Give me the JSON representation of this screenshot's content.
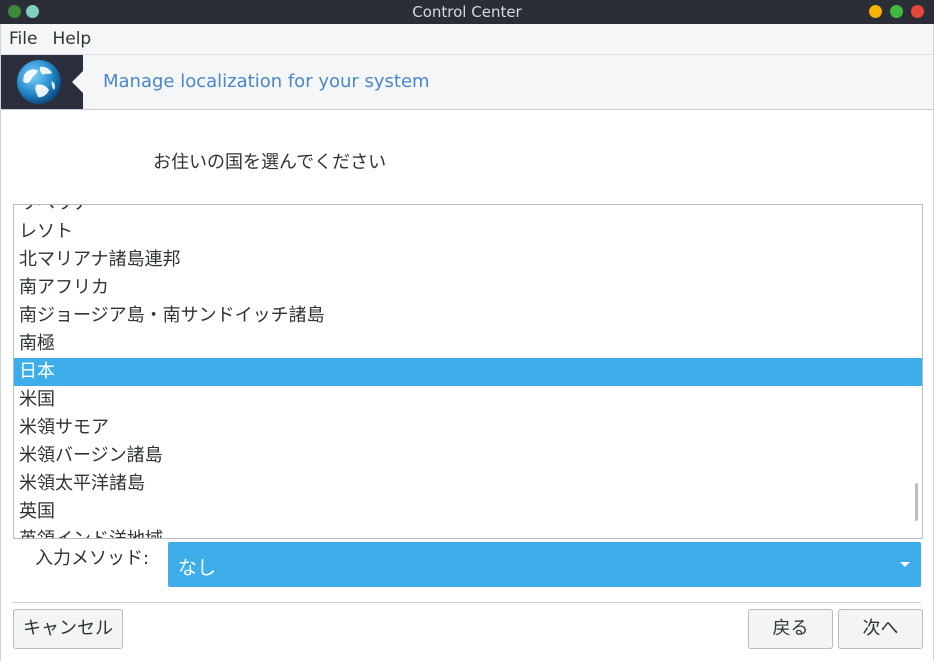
{
  "window": {
    "title": "Control Center"
  },
  "menu": {
    "file": "File",
    "help": "Help"
  },
  "banner": {
    "title": "Manage localization for your system"
  },
  "prompt": "お住いの国を選んでください",
  "countries": [
    "リベリア",
    "レソト",
    "北マリアナ諸島連邦",
    "南アフリカ",
    "南ジョージア島・南サンドイッチ諸島",
    "南極",
    "日本",
    "米国",
    "米領サモア",
    "米領バージン諸島",
    "米領太平洋諸島",
    "英国",
    "英領インド洋地域"
  ],
  "selected_country": "日本",
  "input_method": {
    "label": "入力メソッド:",
    "value": "なし"
  },
  "buttons": {
    "cancel": "キャンセル",
    "back": "戻る",
    "next": "次へ"
  },
  "colors": {
    "accent": "#3daee9",
    "banner_title": "#4a86c8",
    "titlebar": "#2b2e37"
  },
  "icons": {
    "app": "globe-icon",
    "dropdown": "chevron-down-icon"
  }
}
